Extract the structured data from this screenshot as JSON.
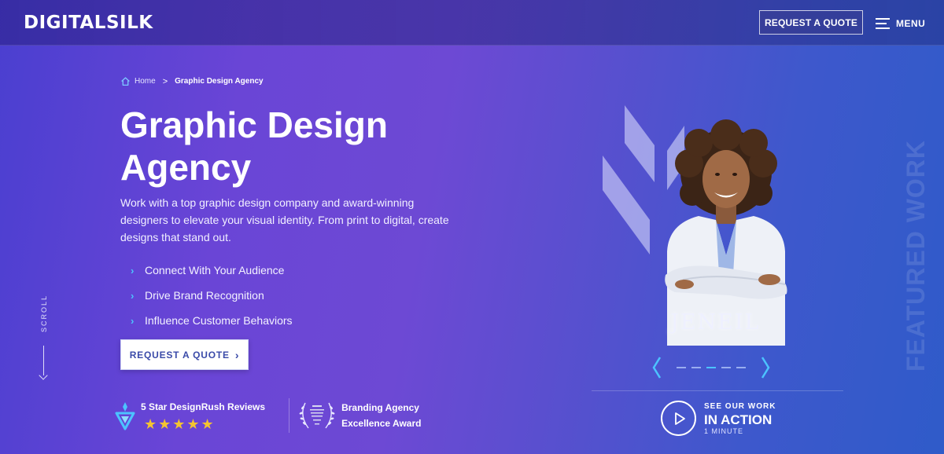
{
  "header": {
    "logo": "DIGITALSILK",
    "request_quote": "REQUEST A QUOTE",
    "menu_label": "MENU"
  },
  "breadcrumb": {
    "home": "Home",
    "separator": ">",
    "current": "Graphic Design Agency"
  },
  "hero": {
    "title": "Graphic Design Agency",
    "description": "Work with a top graphic design company and award-winning designers to elevate your visual identity. From print to digital, create designs that stand out.",
    "features": [
      "Connect With Your Audience",
      "Drive Brand Recognition",
      "Influence Customer Behaviors"
    ],
    "cta": "REQUEST A QUOTE"
  },
  "scroll_label": "SCROLL",
  "awards": {
    "designrush": {
      "text": "5 Star DesignRush Reviews",
      "stars": "★★★★★",
      "rating": 5
    },
    "branding": {
      "line1": "Branding Agency",
      "line2": "Excellence Award"
    }
  },
  "showcase": {
    "side_label": "FEATURED WORK",
    "brand": "JENEIL",
    "slides_total": 5,
    "active_slide": 3
  },
  "see_work": {
    "line1": "SEE OUR WORK",
    "line2": "IN ACTION",
    "line3": "1 MINUTE"
  },
  "colors": {
    "accent": "#4cc3ff",
    "star": "#f4c430",
    "button_text": "#3a4aa8"
  }
}
